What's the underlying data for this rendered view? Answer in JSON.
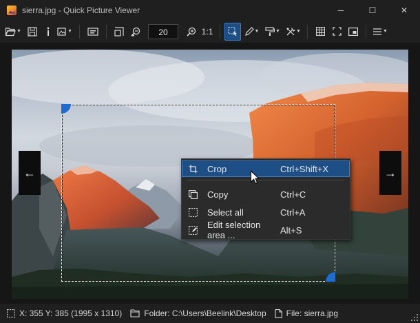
{
  "window": {
    "title": "sierra.jpg - Quick Picture Viewer",
    "minimize": "─",
    "maximize": "☐",
    "close": "✕"
  },
  "toolbar": {
    "zoom_value": "20",
    "ratio_label": "1:1",
    "icons": [
      "open-folder-icon",
      "save-icon",
      "info-icon",
      "image-edit-icon",
      "slideshow-icon",
      "autozoom-icon",
      "zoom-out-icon",
      "zoom-in-icon",
      "select-icon",
      "pencil-icon",
      "paint-icon",
      "tools-icon",
      "grid-icon",
      "fullscreen-icon",
      "picture-in-picture-icon",
      "menu-icon"
    ]
  },
  "viewer": {
    "prev_arrow": "←",
    "next_arrow": "→"
  },
  "context_menu": {
    "items": [
      {
        "label": "Crop",
        "shortcut": "Ctrl+Shift+X",
        "icon": "crop-icon",
        "highlighted": true
      },
      {
        "label": "Copy",
        "shortcut": "Ctrl+C",
        "icon": "copy-icon",
        "highlighted": false
      },
      {
        "label": "Select all",
        "shortcut": "Ctrl+A",
        "icon": "select-all-icon",
        "highlighted": false
      },
      {
        "label": "Edit selection area ...",
        "shortcut": "Alt+S",
        "icon": "edit-selection-icon",
        "highlighted": false
      }
    ]
  },
  "statusbar": {
    "selection": "X: 355 Y: 385 (1995 x 1310)",
    "folder": "Folder: C:\\Users\\Beelink\\Desktop",
    "file": "File: sierra.jpg"
  },
  "colors": {
    "accent": "#1d4f86",
    "accent_border": "#3a7bc8",
    "handle": "#1f6bd0",
    "background": "#1f1f1f"
  }
}
